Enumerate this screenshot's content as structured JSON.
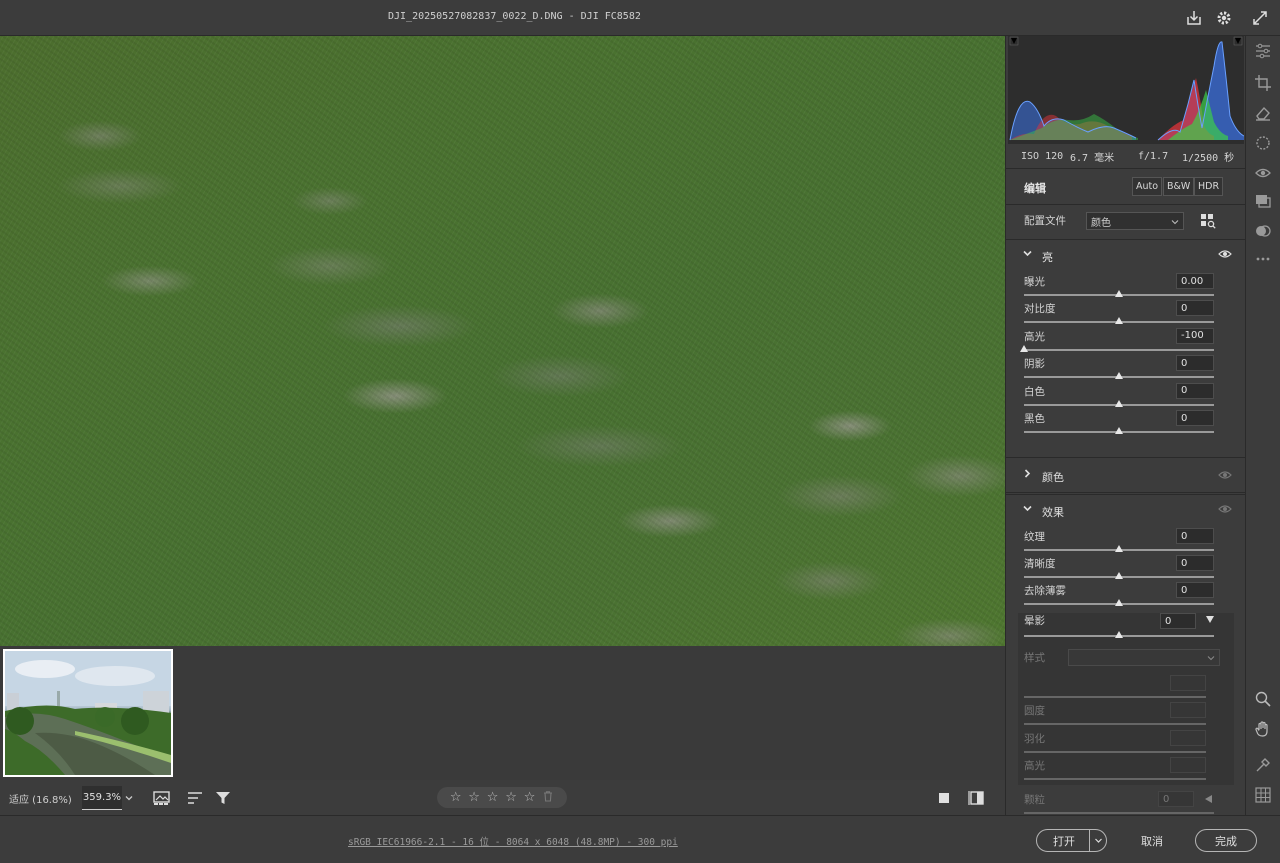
{
  "title": "DJI_20250527082837_0022_D.DNG -  DJI FC8582",
  "exif": {
    "iso": "ISO 120",
    "focal": "6.7 毫米",
    "aperture": "f/1.7",
    "shutter": "1/2500 秒"
  },
  "edit": {
    "title": "编辑",
    "auto": "Auto",
    "bw": "B&W",
    "hdr": "HDR",
    "profile_label": "配置文件",
    "profile_value": "颜色"
  },
  "light": {
    "title": "亮",
    "sliders": [
      {
        "label": "曝光",
        "value": "0.00",
        "fraction": 0.5
      },
      {
        "label": "对比度",
        "value": "0",
        "fraction": 0.5
      },
      {
        "label": "高光",
        "value": "-100",
        "fraction": 0.0
      },
      {
        "label": "阴影",
        "value": "0",
        "fraction": 0.5
      },
      {
        "label": "白色",
        "value": "0",
        "fraction": 0.5
      },
      {
        "label": "黑色",
        "value": "0",
        "fraction": 0.5
      }
    ]
  },
  "color": {
    "title": "颜色"
  },
  "effects": {
    "title": "效果",
    "sliders": [
      {
        "label": "纹理",
        "value": "0",
        "fraction": 0.5
      },
      {
        "label": "清晰度",
        "value": "0",
        "fraction": 0.5
      },
      {
        "label": "去除薄雾",
        "value": "0",
        "fraction": 0.5
      }
    ],
    "vignette": {
      "label": "晕影",
      "value": "0",
      "fraction": 0.5,
      "style_label": "样式",
      "sub": [
        {
          "label": ""
        },
        {
          "label": "圆度"
        },
        {
          "label": "羽化"
        },
        {
          "label": "高光"
        }
      ]
    },
    "grain": {
      "label": "颗粒",
      "value": "0"
    }
  },
  "bottom": {
    "fit": "适应 (16.8%)",
    "zoom": "359.3%"
  },
  "file_info": "sRGB IEC61966-2.1 - 16 位 - 8064 x 6048 (48.8MP) - 300 ppi",
  "buttons": {
    "open": "打开",
    "cancel": "取消",
    "done": "完成"
  },
  "colors": {
    "panel": "#3c3c3c",
    "hist_red": "#e0333a",
    "hist_green": "#3ccf4a",
    "hist_blue": "#3a72e8"
  }
}
